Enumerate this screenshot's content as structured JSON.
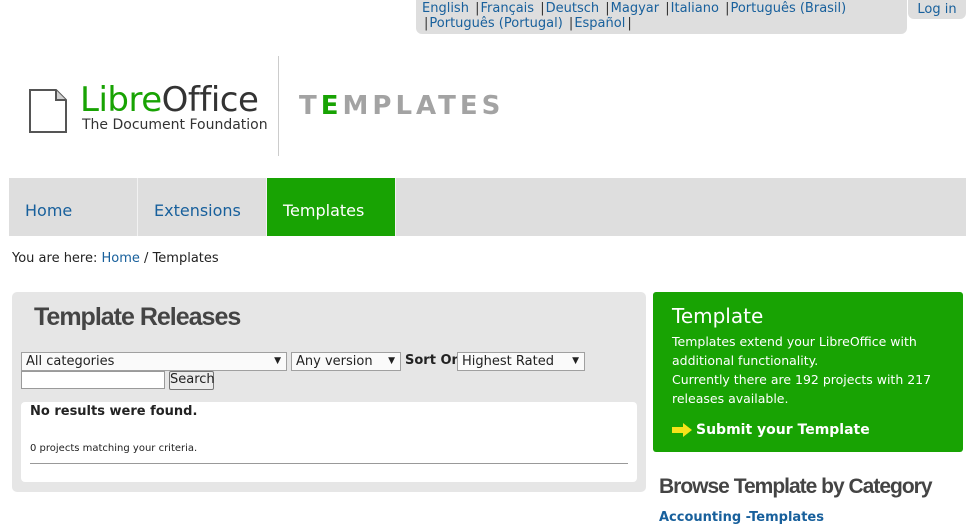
{
  "languages": [
    "English",
    "Français",
    "Deutsch",
    "Magyar",
    "Italiano",
    "Português (Brasil)",
    "Português (Portugal)",
    "Español"
  ],
  "login_label": "Log in",
  "logo": {
    "name_part1": "Libre",
    "name_part2": "Office",
    "tagline": "The Document Foundation"
  },
  "section_title": {
    "first": "T",
    "mark": "E",
    "rest": "MPLATES"
  },
  "nav": [
    {
      "label": "Home",
      "active": false
    },
    {
      "label": "Extensions",
      "active": false
    },
    {
      "label": "Templates",
      "active": true
    }
  ],
  "breadcrumb": {
    "prefix": "You are here:",
    "home": "Home",
    "separator": "/",
    "current": "Templates"
  },
  "main": {
    "title": "Template Releases",
    "category_select": "All categories",
    "version_select": "Any version",
    "sort_label": "Sort On",
    "sort_select": "Highest Rated",
    "search_placeholder": "",
    "search_button": "Search",
    "no_results": "No results were found.",
    "match_count": "0 projects matching your criteria."
  },
  "promo": {
    "title": "Template",
    "line1": "Templates extend your LibreOffice with additional functionality.",
    "line2": "Currently there are 192 projects with 217 releases available.",
    "cta": "Submit your Template"
  },
  "browse": {
    "title": "Browse Template by Category",
    "first_category": "Accounting -Templates"
  },
  "colors": {
    "brand_green": "#18a303",
    "link_blue": "#18609c",
    "bar_gray": "#dedede",
    "arrow_yellow": "#f5e31a"
  },
  "icons": {
    "document": "document-icon",
    "arrow": "arrow-right-icon",
    "dropdown": "caret-down-icon"
  }
}
